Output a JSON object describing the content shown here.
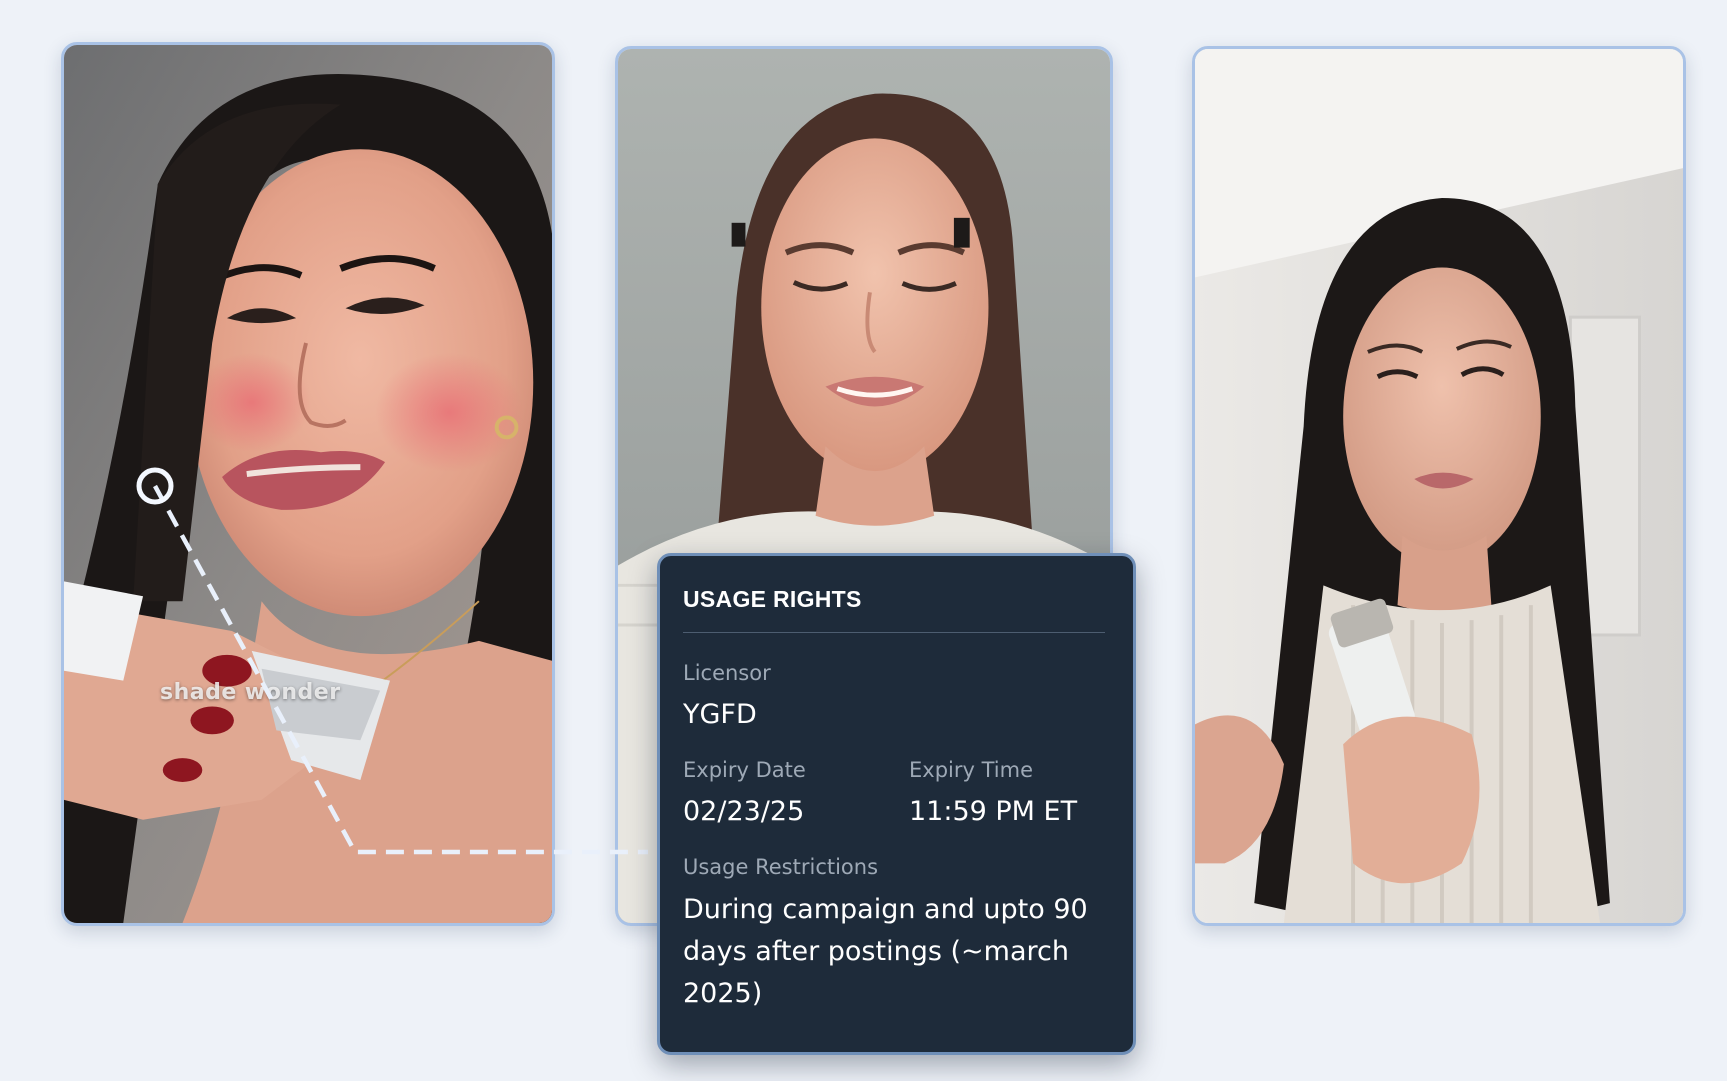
{
  "usage_rights": {
    "title": "USAGE RIGHTS",
    "licensor_label": "Licensor",
    "licensor_value": "YGFD",
    "expiry_date_label": "Expiry Date",
    "expiry_date_value": "02/23/25",
    "expiry_time_label": "Expiry Time",
    "expiry_time_value": "11:59 PM ET",
    "restrictions_label": "Usage Restrictions",
    "restrictions_value": "During campaign and upto 90 days after postings (~march 2025)"
  },
  "videos": {
    "first_caption": "shade wonder"
  },
  "colors": {
    "page_background": "#eef2f8",
    "panel_background": "#1e2b3a",
    "card_border": "#a9c2e6",
    "connector": "#e9f0fb"
  }
}
